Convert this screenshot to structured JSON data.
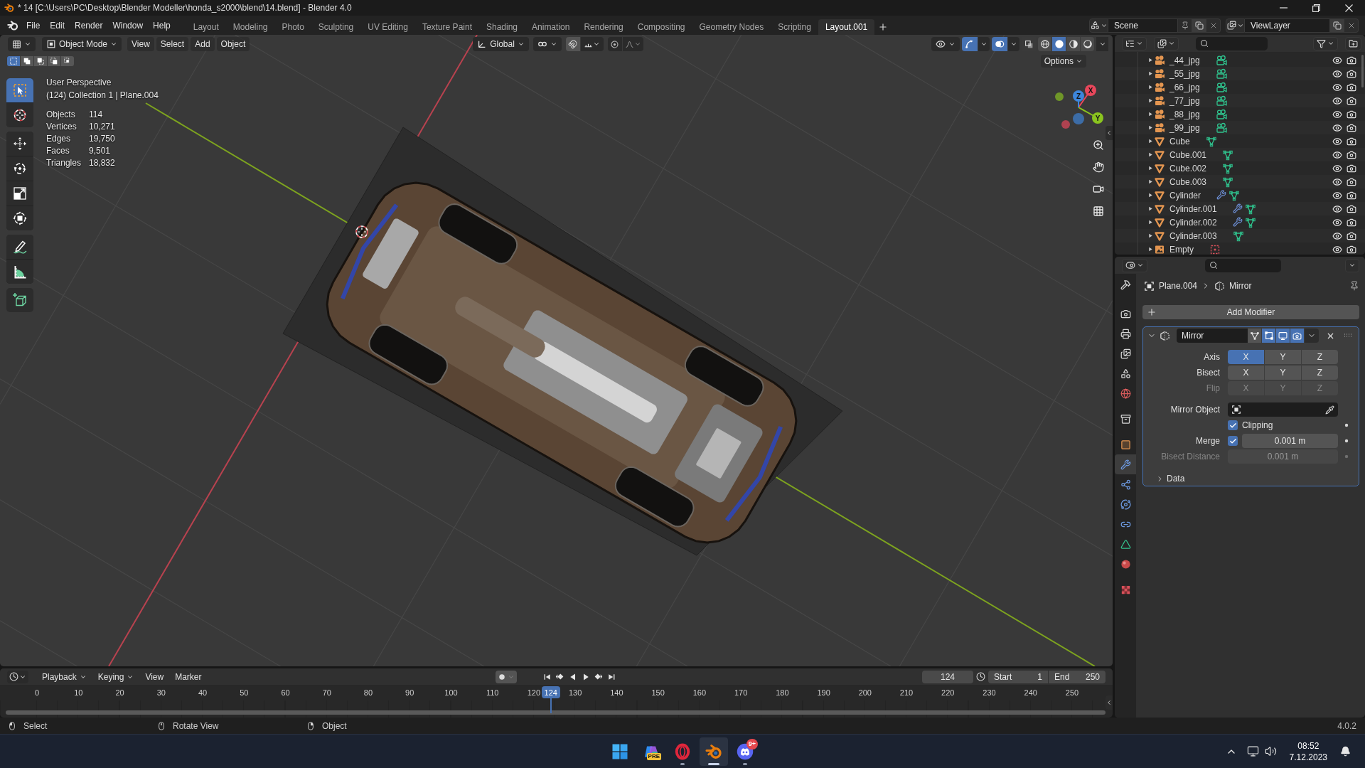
{
  "window": {
    "title": "* 14 [C:\\Users\\PC\\Desktop\\Blender Modeller\\honda_s2000\\blend\\14.blend] - Blender 4.0"
  },
  "menu": [
    "File",
    "Edit",
    "Render",
    "Window",
    "Help"
  ],
  "workspaces": [
    {
      "label": "Layout",
      "selected": false
    },
    {
      "label": "Modeling",
      "selected": false
    },
    {
      "label": "Photo",
      "selected": false
    },
    {
      "label": "Sculpting",
      "selected": false
    },
    {
      "label": "UV Editing",
      "selected": false
    },
    {
      "label": "Texture Paint",
      "selected": false
    },
    {
      "label": "Shading",
      "selected": false
    },
    {
      "label": "Animation",
      "selected": false
    },
    {
      "label": "Rendering",
      "selected": false
    },
    {
      "label": "Compositing",
      "selected": false
    },
    {
      "label": "Geometry Nodes",
      "selected": false
    },
    {
      "label": "Scripting",
      "selected": false
    },
    {
      "label": "Layout.001",
      "selected": true
    }
  ],
  "scene": {
    "value": "Scene"
  },
  "view_layer": {
    "value": "ViewLayer"
  },
  "viewport": {
    "header": {
      "mode": "Object Mode",
      "menus": [
        "View",
        "Select",
        "Add",
        "Object"
      ],
      "orientation": "Global",
      "gizmos": true,
      "overlays": true,
      "xray": false,
      "shading": [
        {
          "kind": "wireframe",
          "selected": false
        },
        {
          "kind": "solid",
          "selected": true
        },
        {
          "kind": "material",
          "selected": false
        },
        {
          "kind": "rendered",
          "selected": false
        }
      ]
    },
    "select_modes": [
      {
        "kind": "new",
        "selected": true
      },
      {
        "kind": "extend",
        "selected": false
      },
      {
        "kind": "subtract",
        "selected": false
      },
      {
        "kind": "invert",
        "selected": false
      },
      {
        "kind": "intersect",
        "selected": false
      }
    ],
    "options": "Options",
    "tool_groups": [
      [
        {
          "kind": "select-box",
          "selected": true
        },
        {
          "kind": "cursor",
          "selected": false
        }
      ],
      [
        {
          "kind": "move",
          "selected": false
        },
        {
          "kind": "rotate",
          "selected": false
        },
        {
          "kind": "scale",
          "selected": false
        },
        {
          "kind": "transform",
          "selected": false
        }
      ],
      [
        {
          "kind": "annotate",
          "selected": false
        },
        {
          "kind": "measure",
          "selected": false
        }
      ],
      [
        {
          "kind": "add-cube",
          "selected": false
        }
      ]
    ],
    "perspective": "User Perspective",
    "context": "(124) Collection 1 | Plane.004",
    "stats": [
      {
        "label": "Objects",
        "value": "114"
      },
      {
        "label": "Vertices",
        "value": "10,271"
      },
      {
        "label": "Edges",
        "value": "19,750"
      },
      {
        "label": "Faces",
        "value": "9,501"
      },
      {
        "label": "Triangles",
        "value": "18,832"
      }
    ],
    "gizmo": [
      {
        "label": "X",
        "color": "#e8475b"
      },
      {
        "label": "Y",
        "color": "#8ac41f"
      },
      {
        "label": "Z",
        "color": "#3d86dc"
      }
    ]
  },
  "outliner": {
    "rows": [
      {
        "name": "_44_jpg",
        "kind": "camera",
        "modifier": false,
        "visible": true,
        "renderable": true
      },
      {
        "name": "_55_jpg",
        "kind": "camera",
        "modifier": false,
        "visible": true,
        "renderable": true
      },
      {
        "name": "_66_jpg",
        "kind": "camera",
        "modifier": false,
        "visible": true,
        "renderable": true
      },
      {
        "name": "_77_jpg",
        "kind": "camera",
        "modifier": false,
        "visible": true,
        "renderable": true
      },
      {
        "name": "_88_jpg",
        "kind": "camera",
        "modifier": false,
        "visible": true,
        "renderable": true
      },
      {
        "name": "_99_jpg",
        "kind": "camera",
        "modifier": false,
        "visible": true,
        "renderable": true
      },
      {
        "name": "Cube",
        "kind": "mesh",
        "modifier": false,
        "visible": true,
        "renderable": true
      },
      {
        "name": "Cube.001",
        "kind": "mesh",
        "modifier": false,
        "visible": true,
        "renderable": true
      },
      {
        "name": "Cube.002",
        "kind": "mesh",
        "modifier": false,
        "visible": true,
        "renderable": true
      },
      {
        "name": "Cube.003",
        "kind": "mesh",
        "modifier": false,
        "visible": true,
        "renderable": true
      },
      {
        "name": "Cylinder",
        "kind": "mesh",
        "modifier": true,
        "visible": true,
        "renderable": true
      },
      {
        "name": "Cylinder.001",
        "kind": "mesh",
        "modifier": true,
        "visible": true,
        "renderable": true
      },
      {
        "name": "Cylinder.002",
        "kind": "mesh",
        "modifier": true,
        "visible": true,
        "renderable": true
      },
      {
        "name": "Cylinder.003",
        "kind": "mesh",
        "modifier": false,
        "visible": true,
        "renderable": true
      },
      {
        "name": "Empty",
        "kind": "image-empty",
        "modifier": false,
        "visible": true,
        "renderable": true
      }
    ]
  },
  "properties": {
    "tab_groups": [
      [
        {
          "kind": "tool",
          "selected": false
        }
      ],
      [
        {
          "kind": "render",
          "selected": false
        },
        {
          "kind": "output",
          "selected": false
        },
        {
          "kind": "view-layer",
          "selected": false
        },
        {
          "kind": "scene",
          "selected": false
        },
        {
          "kind": "world",
          "selected": false
        }
      ],
      [
        {
          "kind": "collection",
          "selected": false
        }
      ],
      [
        {
          "kind": "object",
          "selected": false
        },
        {
          "kind": "modifiers",
          "selected": true
        },
        {
          "kind": "particles",
          "selected": false
        },
        {
          "kind": "physics",
          "selected": false
        },
        {
          "kind": "constraints",
          "selected": false
        },
        {
          "kind": "data",
          "selected": false
        },
        {
          "kind": "material",
          "selected": false
        }
      ],
      [
        {
          "kind": "texture",
          "selected": false
        }
      ]
    ],
    "breadcrumb": {
      "object": "Plane.004",
      "modifier": "Mirror"
    },
    "add_modifier": "Add Modifier",
    "modifier": {
      "name": "Mirror",
      "expanded": true,
      "toggles": [
        {
          "kind": "on-cage",
          "on": false
        },
        {
          "kind": "edit-mode",
          "on": true
        },
        {
          "kind": "viewport",
          "on": true
        },
        {
          "kind": "render",
          "on": true
        }
      ],
      "axis_rows": [
        {
          "label": "Axis",
          "disabled": false,
          "buttons": [
            {
              "label": "X",
              "selected": true
            },
            {
              "label": "Y",
              "selected": false
            },
            {
              "label": "Z",
              "selected": false
            }
          ]
        },
        {
          "label": "Bisect",
          "disabled": false,
          "buttons": [
            {
              "label": "X",
              "selected": false
            },
            {
              "label": "Y",
              "selected": false
            },
            {
              "label": "Z",
              "selected": false
            }
          ]
        },
        {
          "label": "Flip",
          "disabled": true,
          "buttons": [
            {
              "label": "X",
              "selected": false
            },
            {
              "label": "Y",
              "selected": false
            },
            {
              "label": "Z",
              "selected": false
            }
          ]
        }
      ],
      "mirror_object": {
        "label": "Mirror Object"
      },
      "clipping": {
        "label": "Clipping",
        "checked": true
      },
      "merge": {
        "label": "Merge",
        "checked": true,
        "value": "0.001 m"
      },
      "bisect_distance": {
        "label": "Bisect Distance",
        "value": "0.001 m",
        "disabled": true
      },
      "data": {
        "label": "Data",
        "expanded": false
      }
    }
  },
  "timeline": {
    "menus": [
      "Playback",
      "Keying",
      "View",
      "Marker"
    ],
    "auto_keying": false,
    "frame": "124",
    "start_label": "Start",
    "start": "1",
    "end_label": "End",
    "end": "250",
    "ticks": [
      "0",
      "10",
      "20",
      "30",
      "40",
      "50",
      "60",
      "70",
      "80",
      "90",
      "100",
      "110",
      "120",
      "130",
      "140",
      "150",
      "160",
      "170",
      "180",
      "190",
      "200",
      "210",
      "220",
      "230",
      "240",
      "250"
    ],
    "playhead": {
      "label": "124",
      "level": 0.496
    }
  },
  "status_bar": {
    "items": [
      {
        "kind": "left-mouse",
        "label": "Select"
      },
      {
        "kind": "middle-mouse",
        "label": "Rotate View"
      },
      {
        "kind": "right-mouse",
        "label": "Object"
      }
    ],
    "version": "4.0.2"
  },
  "taskbar": {
    "apps": [
      {
        "kind": "start",
        "running": false,
        "active": false
      },
      {
        "kind": "copilot",
        "running": false,
        "active": false,
        "badge": {
          "kind": "tag",
          "label": "PRE"
        }
      },
      {
        "kind": "opera",
        "running": true,
        "active": false
      },
      {
        "kind": "blender",
        "running": true,
        "active": true
      },
      {
        "kind": "discord",
        "running": true,
        "active": false,
        "badge": {
          "kind": "count",
          "label": "9+"
        }
      }
    ],
    "time": "08:52",
    "date": "7.12.2023"
  }
}
